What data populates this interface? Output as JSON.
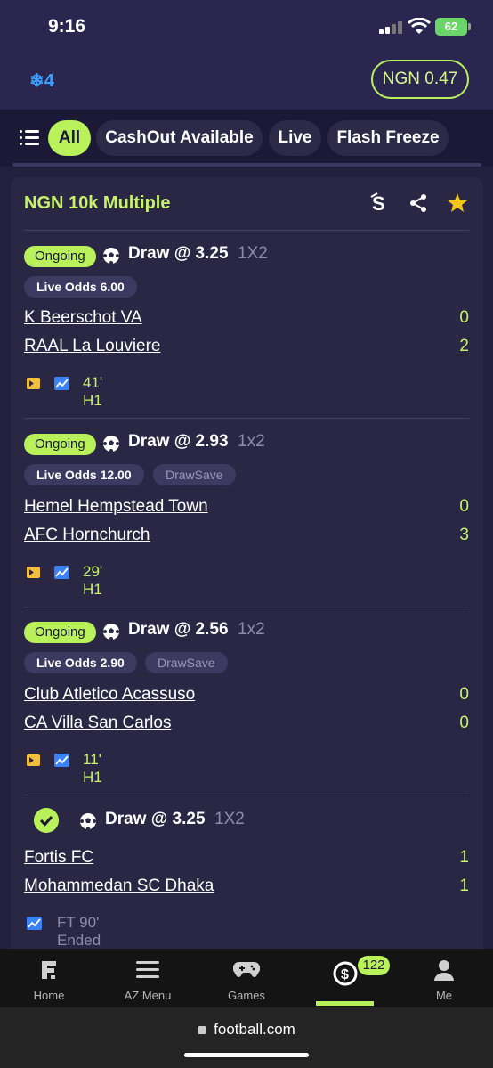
{
  "status": {
    "time": "9:16",
    "battery": "62"
  },
  "header": {
    "freeze_count": "4",
    "balance": "NGN 0.47"
  },
  "filters": [
    {
      "label": "All"
    },
    {
      "label": "CashOut Available"
    },
    {
      "label": "Live"
    },
    {
      "label": "Flash Freeze"
    }
  ],
  "bet": {
    "title": "NGN 10k  Multiple",
    "selections": [
      {
        "status": "Ongoing",
        "pick": "Draw @ 3.25",
        "market": "1X2",
        "live_odds": "Live Odds 6.00",
        "extra_tag": "",
        "home": "K Beerschot VA",
        "away": "RAAL La Louviere",
        "home_score": "0",
        "away_score": "2",
        "time": "41' H1"
      },
      {
        "status": "Ongoing",
        "pick": "Draw @ 2.93",
        "market": "1x2",
        "live_odds": "Live Odds 12.00",
        "extra_tag": "DrawSave",
        "home": "Hemel Hempstead Town",
        "away": "AFC Hornchurch",
        "home_score": "0",
        "away_score": "3",
        "time": "29' H1"
      },
      {
        "status": "Ongoing",
        "pick": "Draw @ 2.56",
        "market": "1x2",
        "live_odds": "Live Odds 2.90",
        "extra_tag": "DrawSave",
        "home": "Club Atletico Acassuso",
        "away": "CA Villa San Carlos",
        "home_score": "0",
        "away_score": "0",
        "time": "11' H1"
      },
      {
        "status": "won",
        "pick": "Draw @ 3.25",
        "market": "1X2",
        "home": "Fortis FC",
        "away": "Mohammedan SC Dhaka",
        "home_score": "1",
        "away_score": "1",
        "time": "FT 90' Ended"
      }
    ]
  },
  "nav": {
    "home": "Home",
    "az": "AZ Menu",
    "games": "Games",
    "open_bets_count": "122",
    "me": "Me"
  },
  "browser": {
    "url": "football.com"
  },
  "colors": {
    "accent": "#b8f15a",
    "score": "#c7f26a",
    "background": "#23203d",
    "card": "#2a2745"
  }
}
